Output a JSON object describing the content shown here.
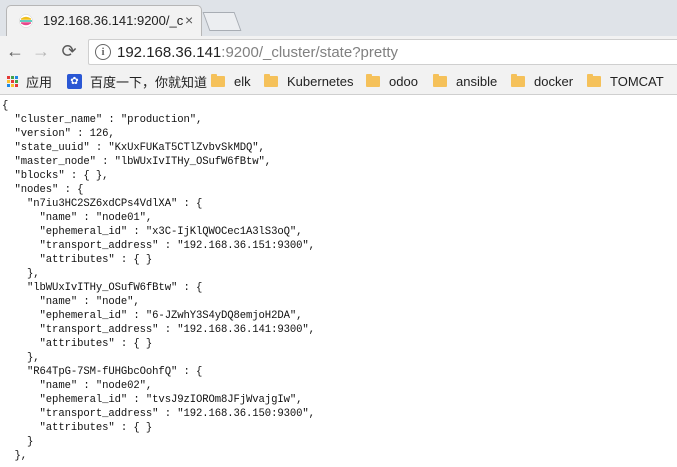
{
  "browser": {
    "tab": {
      "title": "192.168.36.141:9200/_c",
      "favicon": "elastic-icon"
    },
    "address": {
      "host": "192.168.36.141",
      "rest": ":9200/_cluster/state?pretty"
    },
    "nav": {
      "back": "←",
      "forward": "→",
      "reload": "⟳",
      "info": "i"
    }
  },
  "bookmarks": [
    {
      "label": "应用",
      "icon": "apps-icon"
    },
    {
      "label": "百度一下，你就知道",
      "icon": "baidu-icon"
    },
    {
      "label": "elk",
      "icon": "folder-icon"
    },
    {
      "label": "Kubernetes",
      "icon": "folder-icon"
    },
    {
      "label": "odoo",
      "icon": "folder-icon"
    },
    {
      "label": "ansible",
      "icon": "folder-icon"
    },
    {
      "label": "docker",
      "icon": "folder-icon"
    },
    {
      "label": "TOMCAT",
      "icon": "folder-icon"
    }
  ],
  "page": {
    "json_text": "{\n  \"cluster_name\" : \"production\",\n  \"version\" : 126,\n  \"state_uuid\" : \"KxUxFUKaT5CTlZvbvSkMDQ\",\n  \"master_node\" : \"lbWUxIvITHy_OSufW6fBtw\",\n  \"blocks\" : { },\n  \"nodes\" : {\n    \"n7iu3HC2SZ6xdCPs4VdlXA\" : {\n      \"name\" : \"node01\",\n      \"ephemeral_id\" : \"x3C-IjKlQWOCec1A3lS3oQ\",\n      \"transport_address\" : \"192.168.36.151:9300\",\n      \"attributes\" : { }\n    },\n    \"lbWUxIvITHy_OSufW6fBtw\" : {\n      \"name\" : \"node\",\n      \"ephemeral_id\" : \"6-JZwhY3S4yDQ8emjoH2DA\",\n      \"transport_address\" : \"192.168.36.141:9300\",\n      \"attributes\" : { }\n    },\n    \"R64TpG-7SM-fUHGbcOohfQ\" : {\n      \"name\" : \"node02\",\n      \"ephemeral_id\" : \"tvsJ9zIOROm8JFjWvajgIw\",\n      \"transport_address\" : \"192.168.36.150:9300\",\n      \"attributes\" : { }\n    }\n  },"
  },
  "colors": {
    "tabstrip": "#dfe3e8",
    "toolbar": "#f2f2f2",
    "folder": "#f5c15a",
    "baidu": "#2a57d4"
  }
}
